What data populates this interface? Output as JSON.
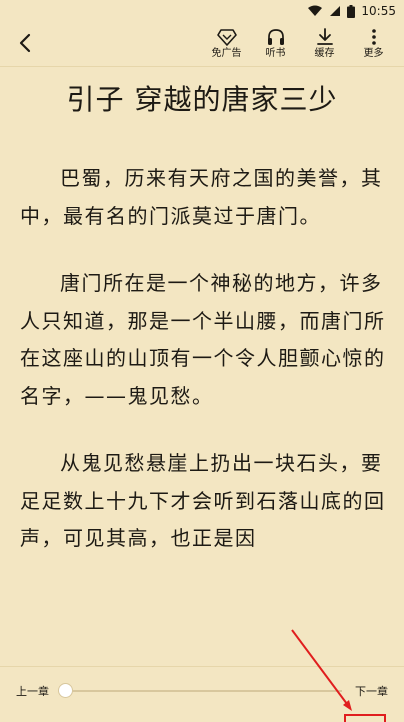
{
  "status": {
    "time": "10:55"
  },
  "toolbar": {
    "back_icon": "back-arrow-icon",
    "actions": [
      {
        "label": "免广告",
        "icon": "diamond-icon"
      },
      {
        "label": "听书",
        "icon": "headphones-icon"
      },
      {
        "label": "缓存",
        "icon": "download-icon"
      },
      {
        "label": "更多",
        "icon": "more-vertical-icon"
      }
    ]
  },
  "chapter": {
    "title": "引子 穿越的唐家三少",
    "paragraphs": [
      "巴蜀，历来有天府之国的美誉，其中，最有名的门派莫过于唐门。",
      "唐门所在是一个神秘的地方，许多人只知道，那是一个半山腰，而唐门所在这座山的山顶有一个令人胆颤心惊的名字，——鬼见愁。",
      "从鬼见愁悬崖上扔出一块石头，要足足数上十九下才会听到石落山底的回声，可见其高，也正是因"
    ]
  },
  "footer": {
    "prev_label": "上一章",
    "next_label": "下一章",
    "progress": 0
  },
  "colors": {
    "page_background": "#f3e6c2",
    "text": "#1d1a14",
    "annotation": "#e01e1e"
  }
}
